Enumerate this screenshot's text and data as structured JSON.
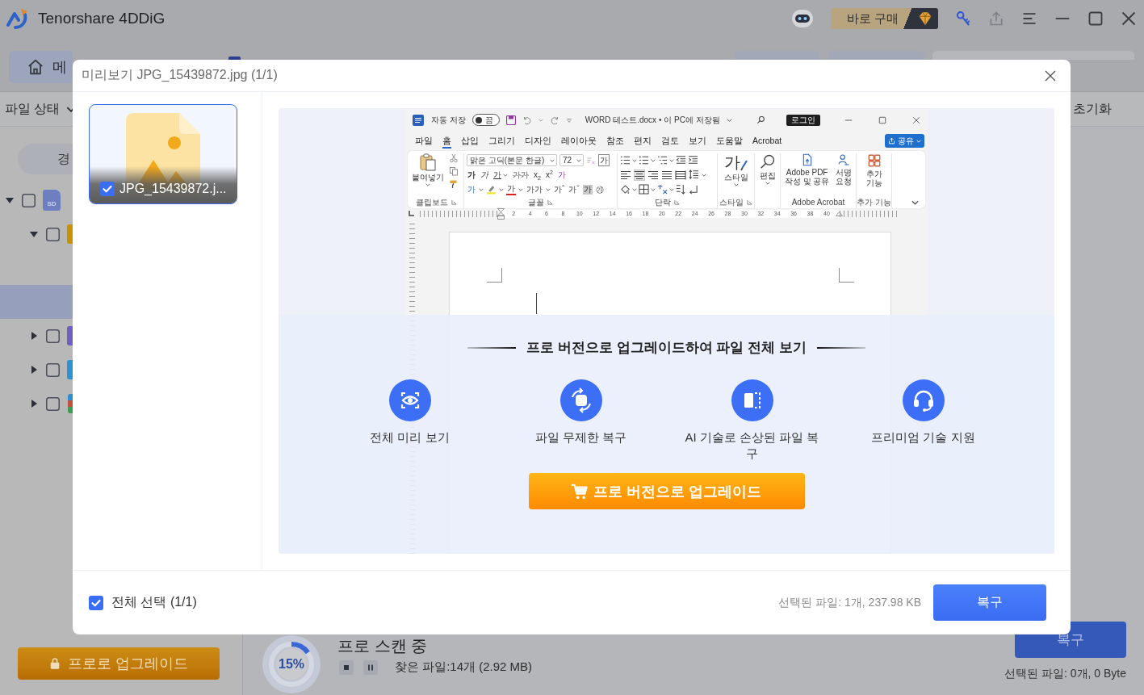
{
  "app_bar": {
    "title": "Tenorshare 4DDiG",
    "buy_button": "바로 구매"
  },
  "nav_tabs": [
    {
      "label": "메",
      "selected": true
    }
  ],
  "filter_bar": {
    "status_filter": "파일 상태",
    "reset": "초기화"
  },
  "sidebar": {
    "path_tab": "경",
    "tree": [
      {
        "kind": "sd",
        "icon_label": "SD",
        "expanded": true,
        "checked": false,
        "children": [
          {
            "kind": "file",
            "color": "#c99300",
            "expanded": true,
            "checked": false,
            "children": [
              {
                "selected": false
              },
              {
                "selected": true
              }
            ]
          },
          {
            "kind": "file",
            "color": "#6e60c2",
            "expanded": false,
            "checked": false
          },
          {
            "kind": "file",
            "color": "#2b93d2",
            "expanded": false,
            "checked": false
          },
          {
            "kind": "mixed",
            "expanded": false,
            "checked": false
          }
        ]
      }
    ],
    "upgrade_button": "프로로 업그레이드"
  },
  "scan_bar": {
    "level": 0.15,
    "percent": "15%",
    "status": "프로 스캔 중",
    "found": "찾은 파일:14개 (2.92 MB)",
    "recover_button": "복구",
    "selection": "선택된 파일: 0개, 0 Byte"
  },
  "preview_dialog": {
    "title": "미리보기 JPG_15439872.jpg (1/1)",
    "thumbnails": [
      {
        "name": "JPG_15439872.j...",
        "checked": true,
        "selected": true
      }
    ],
    "document_window": {
      "autosave_label": "자동 저장",
      "autosave_toggle": {
        "label": "끔",
        "on": false
      },
      "title": "WORD 테스트.docx • 이 PC에 저장됨",
      "sign_in_button": "로그인",
      "tabs": [
        {
          "label": "파일",
          "selected": false
        },
        {
          "label": "홈",
          "selected": true
        },
        {
          "label": "삽입",
          "selected": false
        },
        {
          "label": "그리기",
          "selected": false
        },
        {
          "label": "디자인",
          "selected": false
        },
        {
          "label": "레이아웃",
          "selected": false
        },
        {
          "label": "참조",
          "selected": false
        },
        {
          "label": "편지",
          "selected": false
        },
        {
          "label": "검토",
          "selected": false
        },
        {
          "label": "보기",
          "selected": false
        },
        {
          "label": "도움말",
          "selected": false
        },
        {
          "label": "Acrobat",
          "selected": false
        }
      ],
      "share_button": "공유",
      "ribbon": {
        "paste_button": "붙여넣기",
        "clipboard_label": "클립보드",
        "font_name": "맑은 고딕(본문 한글)",
        "font_size": "72",
        "boxed_char": "가",
        "font_buttons": [
          {
            "kind": "bold",
            "text": "가"
          },
          {
            "kind": "italic",
            "text": "가"
          },
          {
            "kind": "underline",
            "text": "가"
          },
          {
            "kind": "strike",
            "text": "가가"
          },
          {
            "kind": "plain",
            "text": "x$_{2}$"
          },
          {
            "kind": "plain",
            "text": "x$^{2}$"
          },
          {
            "kind": "clear",
            "text": "가"
          }
        ],
        "font_color_buttons": [
          {
            "kind": "effects",
            "text": "가"
          },
          {
            "kind": "highlighter"
          },
          {
            "kind": "color",
            "text": "가"
          },
          {
            "kind": "case",
            "text": "가가"
          },
          {
            "kind": "plain",
            "text": "가ˆ"
          },
          {
            "kind": "plain",
            "text": "가ˇ"
          },
          {
            "kind": "shaded",
            "text": "가"
          },
          {
            "kind": "plain",
            "text": "㉮"
          }
        ],
        "font_label": "글꼴",
        "alignment": [
          {
            "kind": "left",
            "selected": false
          },
          {
            "kind": "center",
            "selected": true
          },
          {
            "kind": "right",
            "selected": false
          },
          {
            "kind": "justify",
            "selected": false
          },
          {
            "kind": "distributed",
            "selected": false
          }
        ],
        "paragraph_label": "단락",
        "styles_glyph": "가",
        "styles_button": "스타일",
        "styles_label": "스타일",
        "editing_button": "편집",
        "pdf_button": "Adobe PDF 작성 및 공유",
        "sign_button": "서명 요청",
        "acrobat_label": "Adobe Acrobat",
        "addins_button": "추가 기능",
        "addins_label": "추가 기능"
      },
      "ruler_labels": [
        "2",
        "4",
        "6",
        "8",
        "10",
        "12",
        "14",
        "16",
        "18",
        "20",
        "22",
        "24",
        "26",
        "28",
        "30",
        "32",
        "34",
        "36",
        "38",
        "40"
      ]
    },
    "upsell": {
      "heading": "프로 버전으로 업그레이드하여 파일 전체 보기",
      "features": [
        {
          "kind": "preview",
          "label": "전체 미리 보기"
        },
        {
          "kind": "unlimited",
          "label": "파일 무제한 복구"
        },
        {
          "kind": "ai",
          "label": "AI 기술로 손상된 파일 복구"
        },
        {
          "kind": "support",
          "label": "프리미엄 기술 지원"
        }
      ],
      "upgrade_button": "프로 버전으로 업그레이드"
    },
    "select_all": {
      "label": "전체 선택 (1/1)",
      "checked": true
    },
    "selection_summary": "선택된 파일: 1개, 237.98 KB",
    "recover_button": "복구"
  }
}
